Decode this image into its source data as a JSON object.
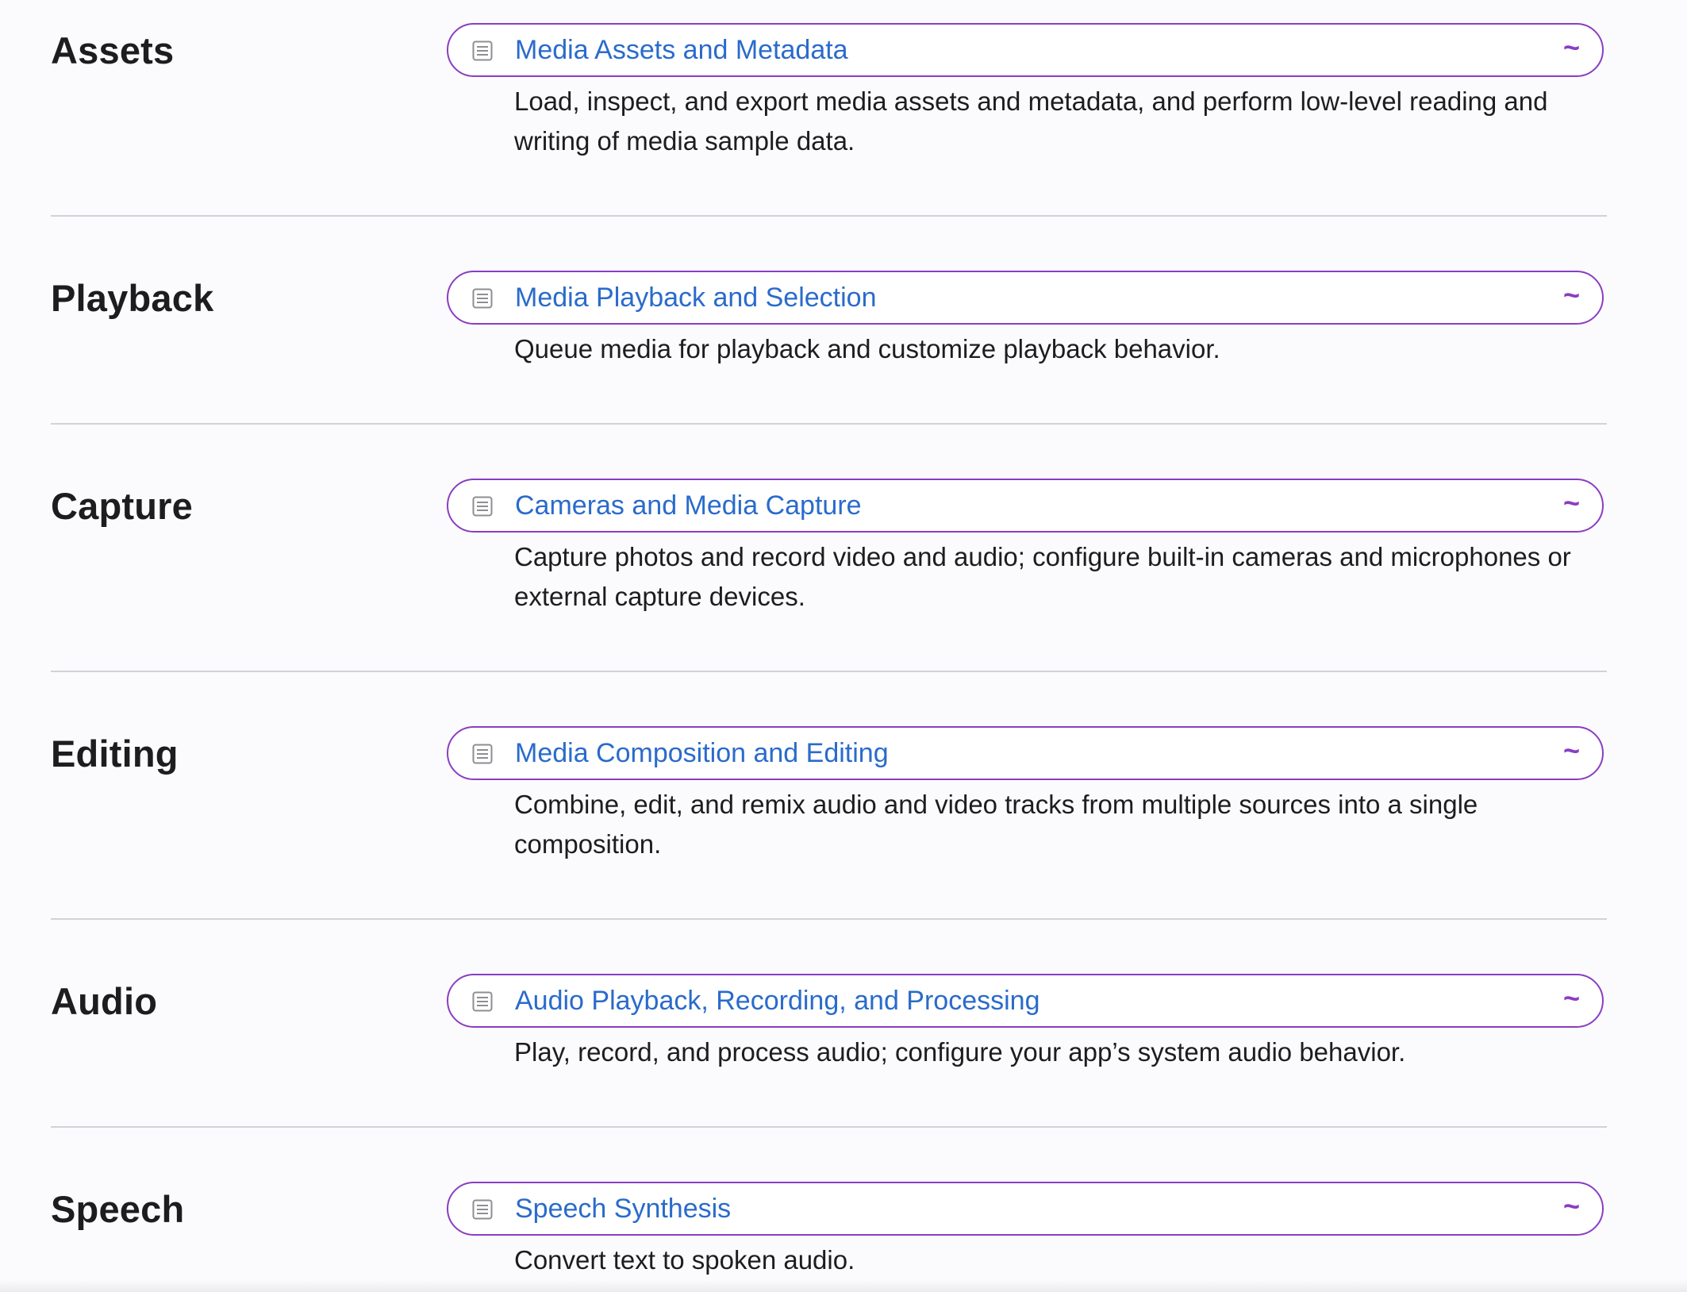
{
  "colors": {
    "accent_border": "#8a3dc2",
    "link": "#2a6bcb",
    "text": "#1d1d1f",
    "divider": "#d2d2d7",
    "background": "#fbfbfd"
  },
  "sections": [
    {
      "title": "Assets",
      "link_label": "Media Assets and Metadata",
      "link_icon": "document-icon",
      "marker": "~",
      "abstract": "Load, inspect, and export media assets and metadata, and perform low-level reading and writing of media sample data."
    },
    {
      "title": "Playback",
      "link_label": "Media Playback and Selection",
      "link_icon": "document-icon",
      "marker": "~",
      "abstract": "Queue media for playback and customize playback behavior."
    },
    {
      "title": "Capture",
      "link_label": "Cameras and Media Capture",
      "link_icon": "document-icon",
      "marker": "~",
      "abstract": "Capture photos and record video and audio; configure built-in cameras and microphones or external capture devices."
    },
    {
      "title": "Editing",
      "link_label": "Media Composition and Editing",
      "link_icon": "document-icon",
      "marker": "~",
      "abstract": "Combine, edit, and remix audio and video tracks from multiple sources into a single composition."
    },
    {
      "title": "Audio",
      "link_label": "Audio Playback, Recording, and Processing",
      "link_icon": "document-icon",
      "marker": "~",
      "abstract": "Play, record, and process audio; configure your app’s system audio behavior."
    },
    {
      "title": "Speech",
      "link_label": "Speech Synthesis",
      "link_icon": "document-icon",
      "marker": "~",
      "abstract": "Convert text to spoken audio."
    }
  ]
}
